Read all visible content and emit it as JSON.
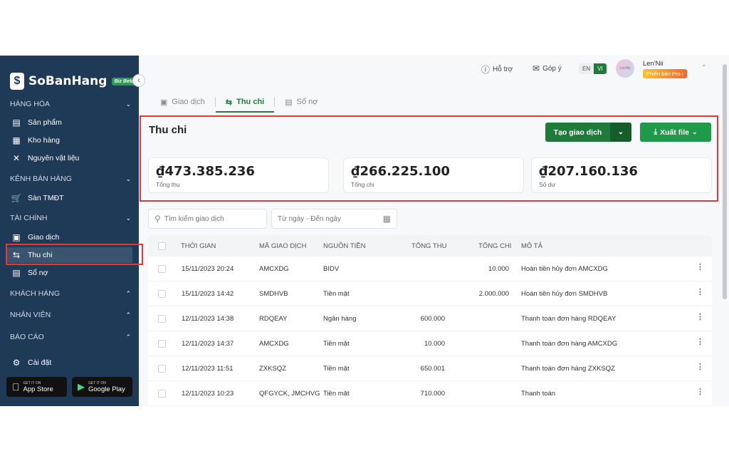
{
  "sidebar": {
    "brand": "SoBanHang",
    "badge": "Biz Beta",
    "sections": [
      {
        "label": "HÀNG HÓA",
        "items": [
          "Sản phẩm",
          "Kho hàng",
          "Nguyên vật liệu"
        ]
      },
      {
        "label": "KÊNH BÁN HÀNG",
        "items": [
          "Sàn TMĐT"
        ]
      },
      {
        "label": "TÀI CHÍNH",
        "items": [
          "Giao dịch",
          "Thu chi",
          "Sổ nợ"
        ]
      },
      {
        "label": "KHÁCH HÀNG"
      },
      {
        "label": "NHÂN VIÊN"
      },
      {
        "label": "BÁO CÁO"
      }
    ],
    "settings": "Cài đặt",
    "appstore": {
      "small": "GET IT ON",
      "big": "App Store"
    },
    "googleplay": {
      "small": "GET IT ON",
      "big": "Google Play"
    }
  },
  "topbar": {
    "help": "Hỗ trợ",
    "feedback": "Góp ý",
    "lang_en": "EN",
    "lang_vi": "VI",
    "avatar_text": "Len'Nii",
    "user_name": "Len'Nii",
    "pro_label": "Phiên bản Pro ›"
  },
  "tabs": [
    {
      "label": "Giao dịch"
    },
    {
      "label": "Thu chi"
    },
    {
      "label": "Sổ nợ"
    }
  ],
  "page": {
    "title": "Thu chi",
    "create_button": "Tạo giao dịch",
    "export_button": "Xuất file"
  },
  "stats": [
    {
      "value": "₫473.385.236",
      "label": "Tổng thu"
    },
    {
      "value": "₫266.225.100",
      "label": "Tổng chi"
    },
    {
      "value": "₫207.160.136",
      "label": "Số dư"
    }
  ],
  "filters": {
    "search_placeholder": "Tìm kiếm giao dịch",
    "date_placeholder": "Từ ngày - Đến ngày"
  },
  "table": {
    "headers": [
      "THỜI GIAN",
      "MÃ GIAO DỊCH",
      "NGUỒN TIỀN",
      "TỔNG THU",
      "TỔNG CHI",
      "MÔ TẢ"
    ],
    "rows": [
      {
        "time": "15/11/2023 20:24",
        "code": "AMCXDG",
        "source": "BIDV",
        "income": "",
        "expense": "10.000",
        "desc": "Hoàn tiền hủy đơn AMCXDG"
      },
      {
        "time": "15/11/2023 14:42",
        "code": "SMDHVB",
        "source": "Tiền mặt",
        "income": "",
        "expense": "2.000.000",
        "desc": "Hoàn tiền hủy đơn SMDHVB"
      },
      {
        "time": "12/11/2023 14:38",
        "code": "RDQEAY",
        "source": "Ngân hàng",
        "income": "600.000",
        "expense": "",
        "desc": "Thanh toán đơn hàng RDQEAY"
      },
      {
        "time": "12/11/2023 14:37",
        "code": "AMCXDG",
        "source": "Tiền mặt",
        "income": "10.000",
        "expense": "",
        "desc": "Thanh toán đơn hàng AMCXDG"
      },
      {
        "time": "12/11/2023 11:51",
        "code": "ZXKSQZ",
        "source": "Tiền mặt",
        "income": "650.001",
        "expense": "",
        "desc": "Thanh toán đơn hàng ZXKSQZ"
      },
      {
        "time": "12/11/2023 10:23",
        "code": "QFGYCK, JMCHVG",
        "source": "Tiền mặt",
        "income": "710.000",
        "expense": "",
        "desc": "Thanh toán"
      }
    ]
  }
}
